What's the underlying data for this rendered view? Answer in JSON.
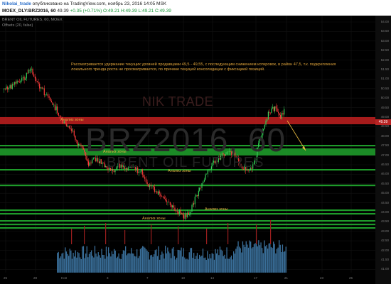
{
  "header": {
    "author": "Nikolai_trade",
    "published": "опубликовано на TradingView.com, ноябрь 23, 2016 14:05 MSK",
    "symbol": "MOEX_DLY:BRZ2016, 60",
    "last": "49.39",
    "change": "+0.35 (+0.71%)",
    "ohlc": "O:49.21 H:49.39 L:49.21 C:49.39"
  },
  "chart": {
    "symbol_label": "BRENT OIL FUTURES, 60, MOEX",
    "offset_label": "Offsets (20, false)",
    "comment": "Рассматривается удержание текущих уровней продавцами 49,5 - 49,55, с последующим снижением котировок, в район 47,5, т.к. подкрепления локального тренда роста не просматривается, по причине текущей консолидации с фиксацией позиций.",
    "watermark_brand": "NIK TRADE",
    "watermark_symbol": "BRZ2016, 60",
    "watermark_desc": "BRENT OIL FUTURES",
    "zone_label": "Анализ зоны",
    "current_price": "49.39",
    "price_ticks": [
      "54.00",
      "53.50",
      "53.00",
      "52.50",
      "52.00",
      "51.50",
      "51.00",
      "50.50",
      "50.00",
      "49.50",
      "49.00",
      "48.50",
      "48.00",
      "47.50",
      "47.00",
      "46.50",
      "46.00",
      "45.50",
      "45.00",
      "44.50",
      "44.00",
      "43.50",
      "43.00",
      "42.50",
      "42.00",
      "41.50",
      "41.00"
    ],
    "time_ticks": [
      "25",
      "28",
      "Ноя",
      "3",
      "7",
      "10",
      "14",
      "17",
      "21",
      "23",
      "25",
      "28",
      "30"
    ],
    "colors": {
      "background": "#000000",
      "candle_up": "#33cc55",
      "candle_down": "#ff3b3b",
      "resistance_zone": "#b81e1e",
      "support_zone": "#1e9a2a",
      "volume": "#3a6f9a",
      "annotation": "#e0a43a"
    }
  }
}
